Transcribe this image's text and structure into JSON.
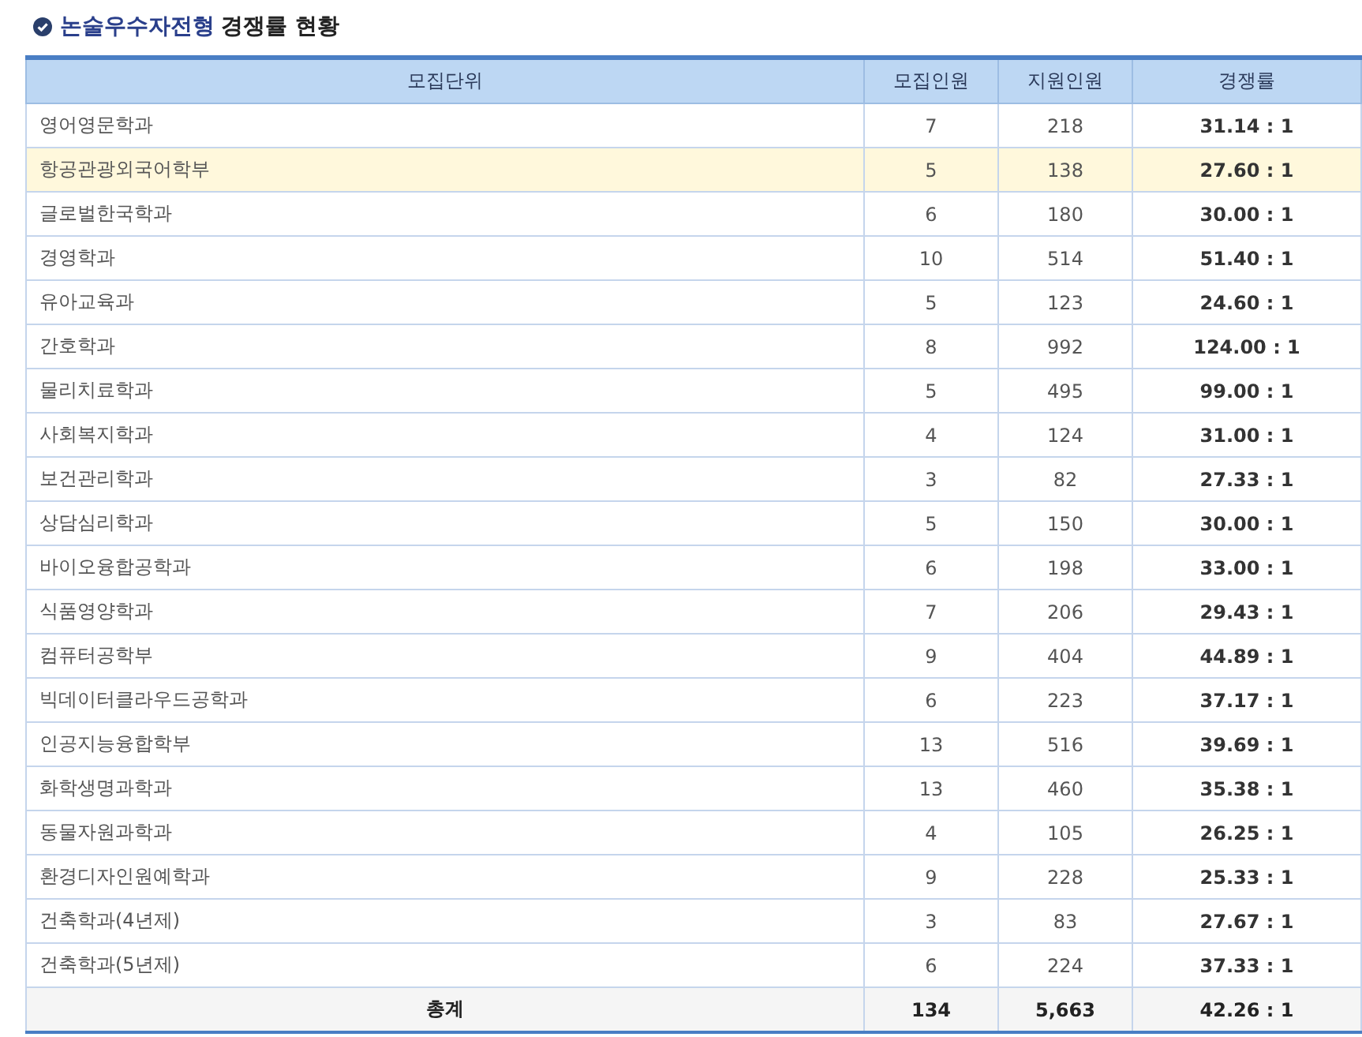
{
  "heading": {
    "category": "논술우수자전형",
    "rest": "경쟁률 현황"
  },
  "table": {
    "columns": [
      "모집단위",
      "모집인원",
      "지원인원",
      "경쟁률"
    ],
    "rows": [
      {
        "unit": "영어영문학과",
        "quota": "7",
        "applicants": "218",
        "ratio": "31.14 : 1",
        "highlighted": false
      },
      {
        "unit": "항공관광외국어학부",
        "quota": "5",
        "applicants": "138",
        "ratio": "27.60 : 1",
        "highlighted": true
      },
      {
        "unit": "글로벌한국학과",
        "quota": "6",
        "applicants": "180",
        "ratio": "30.00 : 1",
        "highlighted": false
      },
      {
        "unit": "경영학과",
        "quota": "10",
        "applicants": "514",
        "ratio": "51.40 : 1",
        "highlighted": false
      },
      {
        "unit": "유아교육과",
        "quota": "5",
        "applicants": "123",
        "ratio": "24.60 : 1",
        "highlighted": false
      },
      {
        "unit": "간호학과",
        "quota": "8",
        "applicants": "992",
        "ratio": "124.00 : 1",
        "highlighted": false
      },
      {
        "unit": "물리치료학과",
        "quota": "5",
        "applicants": "495",
        "ratio": "99.00 : 1",
        "highlighted": false
      },
      {
        "unit": "사회복지학과",
        "quota": "4",
        "applicants": "124",
        "ratio": "31.00 : 1",
        "highlighted": false
      },
      {
        "unit": "보건관리학과",
        "quota": "3",
        "applicants": "82",
        "ratio": "27.33 : 1",
        "highlighted": false
      },
      {
        "unit": "상담심리학과",
        "quota": "5",
        "applicants": "150",
        "ratio": "30.00 : 1",
        "highlighted": false
      },
      {
        "unit": "바이오융합공학과",
        "quota": "6",
        "applicants": "198",
        "ratio": "33.00 : 1",
        "highlighted": false
      },
      {
        "unit": "식품영양학과",
        "quota": "7",
        "applicants": "206",
        "ratio": "29.43 : 1",
        "highlighted": false
      },
      {
        "unit": "컴퓨터공학부",
        "quota": "9",
        "applicants": "404",
        "ratio": "44.89 : 1",
        "highlighted": false
      },
      {
        "unit": "빅데이터클라우드공학과",
        "quota": "6",
        "applicants": "223",
        "ratio": "37.17 : 1",
        "highlighted": false
      },
      {
        "unit": "인공지능융합학부",
        "quota": "13",
        "applicants": "516",
        "ratio": "39.69 : 1",
        "highlighted": false
      },
      {
        "unit": "화학생명과학과",
        "quota": "13",
        "applicants": "460",
        "ratio": "35.38 : 1",
        "highlighted": false
      },
      {
        "unit": "동물자원과학과",
        "quota": "4",
        "applicants": "105",
        "ratio": "26.25 : 1",
        "highlighted": false
      },
      {
        "unit": "환경디자인원예학과",
        "quota": "9",
        "applicants": "228",
        "ratio": "25.33 : 1",
        "highlighted": false
      },
      {
        "unit": "건축학과(4년제)",
        "quota": "3",
        "applicants": "83",
        "ratio": "27.67 : 1",
        "highlighted": false
      },
      {
        "unit": "건축학과(5년제)",
        "quota": "6",
        "applicants": "224",
        "ratio": "37.33 : 1",
        "highlighted": false
      }
    ],
    "total": {
      "label": "총계",
      "quota": "134",
      "applicants": "5,663",
      "ratio": "42.26 : 1"
    }
  }
}
